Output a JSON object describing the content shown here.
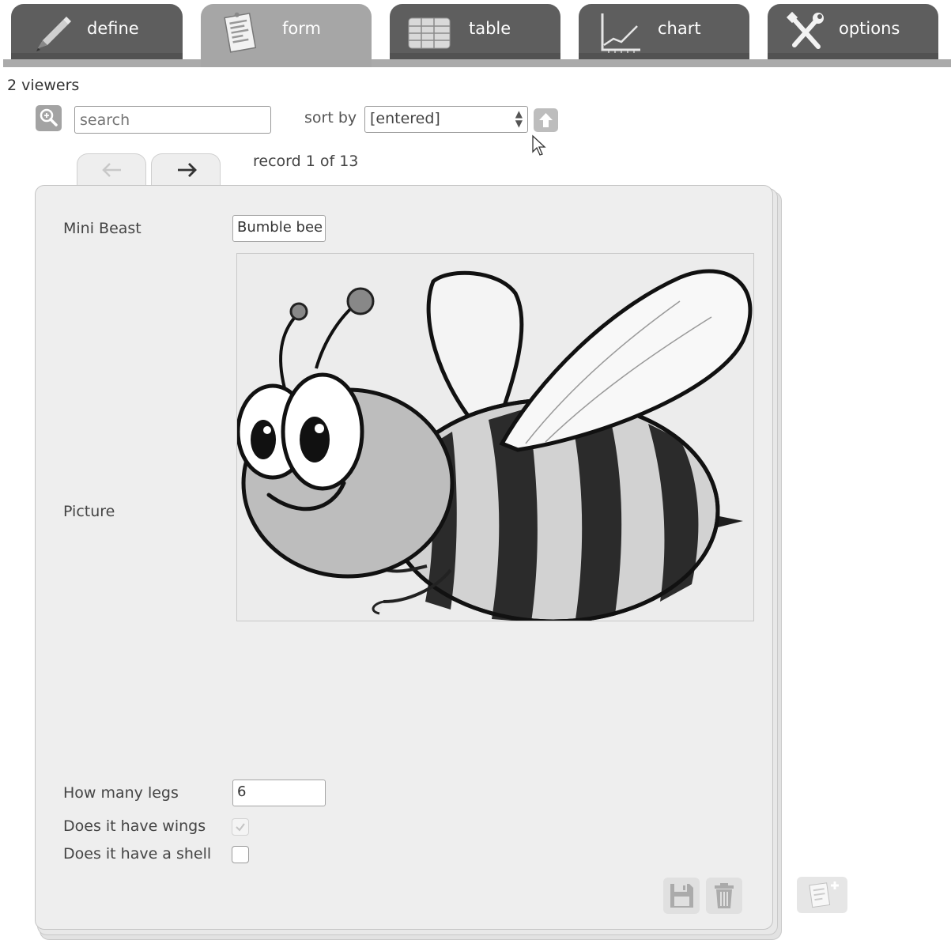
{
  "tabs": [
    {
      "label": "define",
      "icon": "pencil-icon",
      "active": false
    },
    {
      "label": "form",
      "icon": "form-icon",
      "active": true
    },
    {
      "label": "table",
      "icon": "table-icon",
      "active": false
    },
    {
      "label": "chart",
      "icon": "chart-icon",
      "active": false
    },
    {
      "label": "options",
      "icon": "tools-icon",
      "active": false
    }
  ],
  "viewers": "2 viewers",
  "search": {
    "placeholder": "search"
  },
  "sort": {
    "label": "sort by",
    "selected": "[entered]"
  },
  "record_info": "record 1 of 13",
  "form": {
    "fields": {
      "mini_beast": {
        "label": "Mini Beast",
        "value": "Bumble bee"
      },
      "picture": {
        "label": "Picture"
      },
      "legs": {
        "label": "How many legs",
        "value": "6"
      },
      "wings": {
        "label": "Does it have wings",
        "checked": true
      },
      "shell": {
        "label": "Does it have a shell",
        "checked": false
      }
    }
  },
  "colors": {
    "tab_bg": "#5e5e5e",
    "tab_active": "#a6a6a6",
    "card_bg": "#eeeeee"
  }
}
